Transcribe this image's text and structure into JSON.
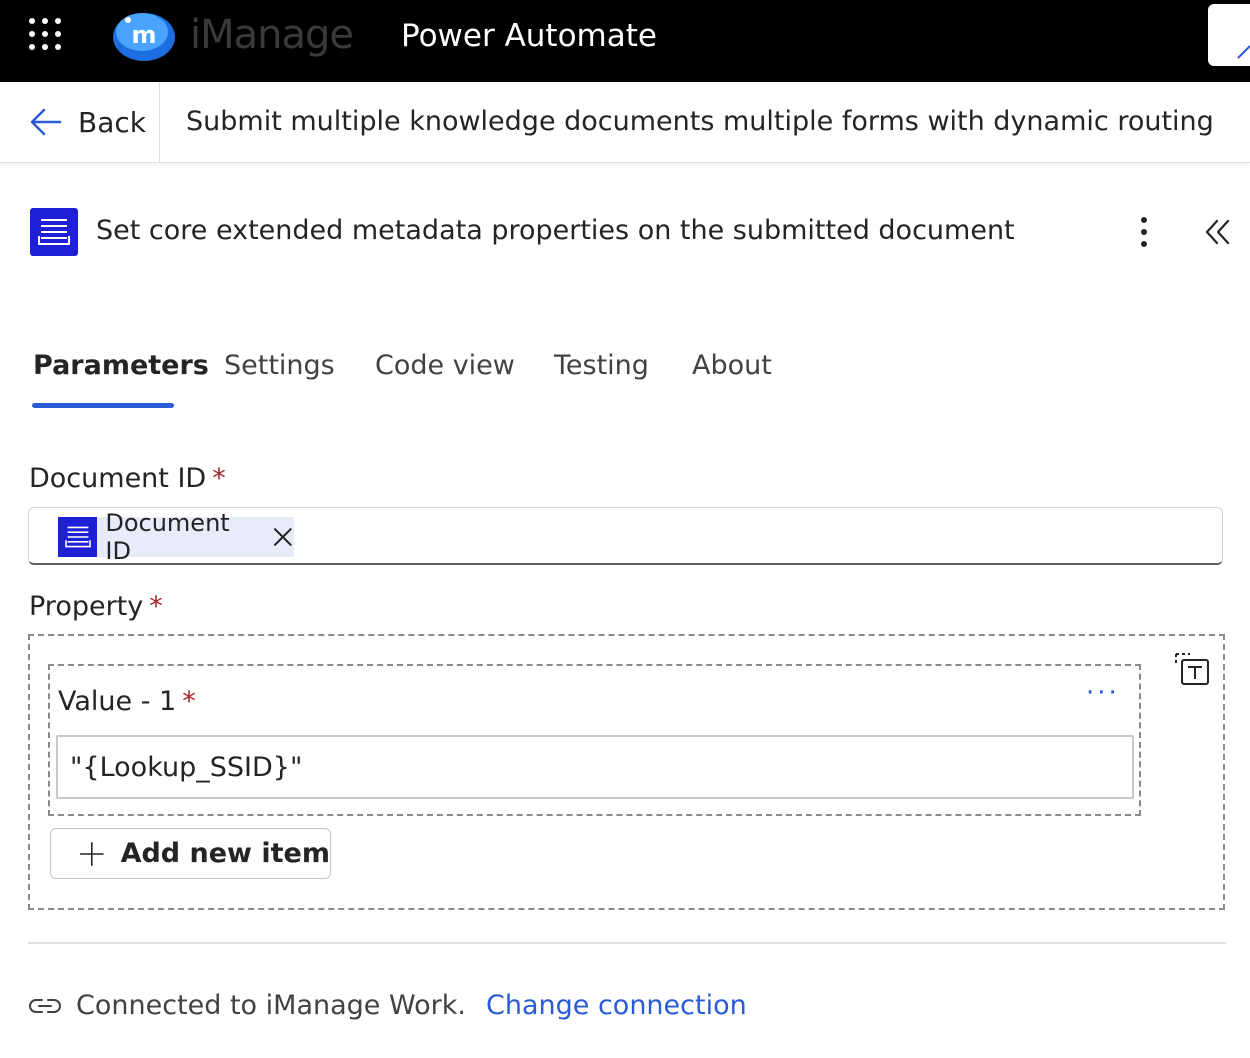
{
  "topbar": {
    "waffle_icon": "waffle-icon",
    "brand_name": "iManage",
    "app_title": "Power Automate",
    "colors": {
      "background": "#000000",
      "text": "#ffffff"
    }
  },
  "header": {
    "back_label": "Back",
    "flow_title": "Submit multiple knowledge documents multiple forms with dynamic routing"
  },
  "action": {
    "icon": "document-list-icon",
    "title": "Set core extended metadata properties on the submitted document",
    "icon_color": "#1f1fd6"
  },
  "tabs": [
    {
      "label": "Parameters",
      "active": true
    },
    {
      "label": "Settings",
      "active": false
    },
    {
      "label": "Code view",
      "active": false
    },
    {
      "label": "Testing",
      "active": false
    },
    {
      "label": "About",
      "active": false
    }
  ],
  "fields": {
    "document_id": {
      "label": "Document ID",
      "required_mark": "*",
      "token_label": "Document ID"
    },
    "property": {
      "label": "Property",
      "required_mark": "*",
      "items": [
        {
          "label": "Value - 1",
          "required_mark": "*",
          "value": "\"{Lookup_SSID}\""
        }
      ],
      "add_item_label": "Add new item"
    }
  },
  "connection": {
    "text": "Connected to iManage Work.",
    "change_label": "Change connection"
  },
  "accent_color": "#2a5bd7",
  "required_color": "#a4262c"
}
